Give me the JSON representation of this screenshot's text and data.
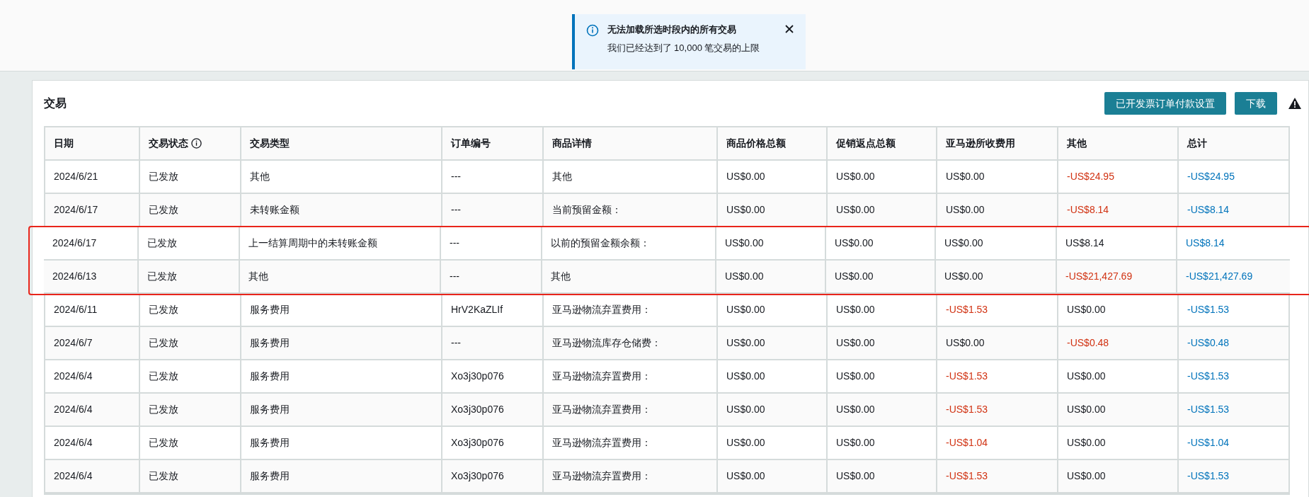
{
  "notice": {
    "title": "无法加载所选时段内的所有交易",
    "message": "我们已经达到了 10,000 笔交易的上限"
  },
  "panel": {
    "title": "交易",
    "buttons": [
      "已开发票订单付款设置",
      "下载"
    ]
  },
  "table": {
    "columns": [
      "日期",
      "交易状态",
      "交易类型",
      "订单编号",
      "商品详情",
      "商品价格总额",
      "促销返点总额",
      "亚马逊所收费用",
      "其他",
      "总计"
    ],
    "rows": [
      {
        "date": "2024/6/21",
        "status": "已发放",
        "type": "其他",
        "order": "---",
        "details": "其他",
        "product_total": "US$0.00",
        "promo_total": "US$0.00",
        "amazon_fees": {
          "text": "US$0.00",
          "negative": false
        },
        "other": {
          "text": "-US$24.95",
          "negative": true
        },
        "total": "-US$24.95",
        "marked": false
      },
      {
        "date": "2024/6/17",
        "status": "已发放",
        "type": "未转账金额",
        "order": "---",
        "details": "当前预留金额：",
        "product_total": "US$0.00",
        "promo_total": "US$0.00",
        "amazon_fees": {
          "text": "US$0.00",
          "negative": false
        },
        "other": {
          "text": "-US$8.14",
          "negative": true
        },
        "total": "-US$8.14",
        "marked": false
      },
      {
        "date": "2024/6/17",
        "status": "已发放",
        "type": "上一结算周期中的未转账金额",
        "order": "---",
        "details": "以前的预留金额余额：",
        "product_total": "US$0.00",
        "promo_total": "US$0.00",
        "amazon_fees": {
          "text": "US$0.00",
          "negative": false
        },
        "other": {
          "text": "US$8.14",
          "negative": false
        },
        "total": "US$8.14",
        "marked": true
      },
      {
        "date": "2024/6/13",
        "status": "已发放",
        "type": "其他",
        "order": "---",
        "details": "其他",
        "product_total": "US$0.00",
        "promo_total": "US$0.00",
        "amazon_fees": {
          "text": "US$0.00",
          "negative": false
        },
        "other": {
          "text": "-US$21,427.69",
          "negative": true
        },
        "total": "-US$21,427.69",
        "marked": true
      },
      {
        "date": "2024/6/11",
        "status": "已发放",
        "type": "服务费用",
        "order": "HrV2KaZLIf",
        "details": "亚马逊物流弃置费用：",
        "product_total": "US$0.00",
        "promo_total": "US$0.00",
        "amazon_fees": {
          "text": "-US$1.53",
          "negative": true
        },
        "other": {
          "text": "US$0.00",
          "negative": false
        },
        "total": "-US$1.53",
        "marked": false
      },
      {
        "date": "2024/6/7",
        "status": "已发放",
        "type": "服务费用",
        "order": "---",
        "details": "亚马逊物流库存仓储费：",
        "product_total": "US$0.00",
        "promo_total": "US$0.00",
        "amazon_fees": {
          "text": "US$0.00",
          "negative": false
        },
        "other": {
          "text": "-US$0.48",
          "negative": true
        },
        "total": "-US$0.48",
        "marked": false
      },
      {
        "date": "2024/6/4",
        "status": "已发放",
        "type": "服务费用",
        "order": "Xo3j30p076",
        "details": "亚马逊物流弃置费用：",
        "product_total": "US$0.00",
        "promo_total": "US$0.00",
        "amazon_fees": {
          "text": "-US$1.53",
          "negative": true
        },
        "other": {
          "text": "US$0.00",
          "negative": false
        },
        "total": "-US$1.53",
        "marked": false
      },
      {
        "date": "2024/6/4",
        "status": "已发放",
        "type": "服务费用",
        "order": "Xo3j30p076",
        "details": "亚马逊物流弃置费用：",
        "product_total": "US$0.00",
        "promo_total": "US$0.00",
        "amazon_fees": {
          "text": "-US$1.53",
          "negative": true
        },
        "other": {
          "text": "US$0.00",
          "negative": false
        },
        "total": "-US$1.53",
        "marked": false
      },
      {
        "date": "2024/6/4",
        "status": "已发放",
        "type": "服务费用",
        "order": "Xo3j30p076",
        "details": "亚马逊物流弃置费用：",
        "product_total": "US$0.00",
        "promo_total": "US$0.00",
        "amazon_fees": {
          "text": "-US$1.04",
          "negative": true
        },
        "other": {
          "text": "US$0.00",
          "negative": false
        },
        "total": "-US$1.04",
        "marked": false
      },
      {
        "date": "2024/6/4",
        "status": "已发放",
        "type": "服务费用",
        "order": "Xo3j30p076",
        "details": "亚马逊物流弃置费用：",
        "product_total": "US$0.00",
        "promo_total": "US$0.00",
        "amazon_fees": {
          "text": "-US$1.53",
          "negative": true
        },
        "other": {
          "text": "US$0.00",
          "negative": false
        },
        "total": "-US$1.53",
        "marked": false
      }
    ]
  }
}
